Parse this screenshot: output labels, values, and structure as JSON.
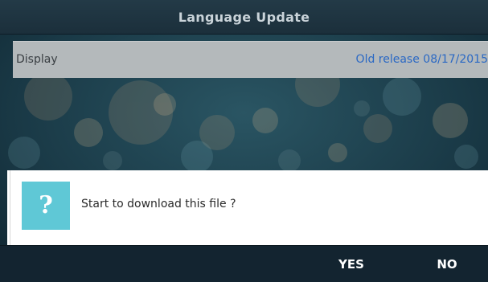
{
  "title": "Language Update",
  "display_row": {
    "label": "Display",
    "value": "Old release 08/17/2015"
  },
  "dialog": {
    "icon": "question-mark-icon",
    "glyph": "?",
    "message": "Start to download this file ?"
  },
  "softkeys": {
    "yes": "YES",
    "no": "NO"
  },
  "colors": {
    "title_bar": "#1f3542",
    "row_bg": "#b4b9bb",
    "row_value": "#2a68c4",
    "icon_bg": "#5fc8d6",
    "softkey_bar": "#132430"
  }
}
